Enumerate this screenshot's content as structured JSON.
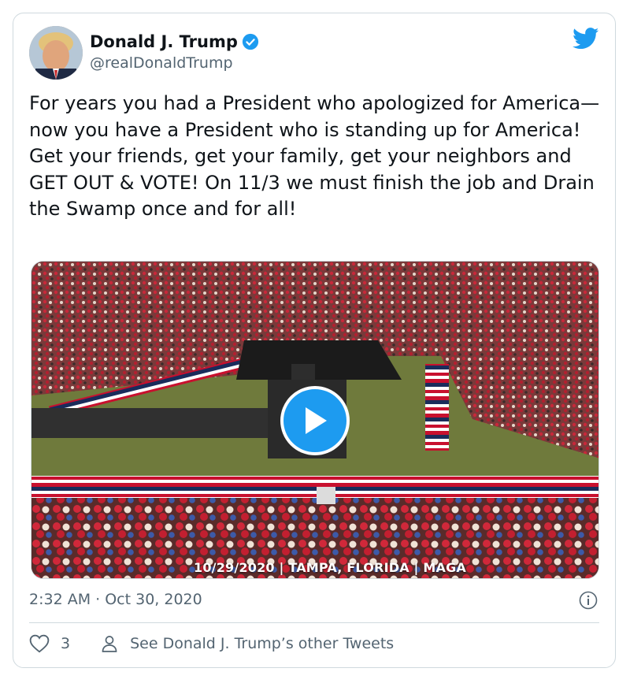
{
  "tweet": {
    "author": {
      "name": "Donald J. Trump",
      "handle": "@realDonaldTrump",
      "verified": true
    },
    "text": "For years you had a President who apologized for America—now you have a President who is standing up for America! Get your friends, get your family, get your neighbors and GET OUT & VOTE! On 11/3 we must finish the job and Drain the Swamp once and for all!",
    "media": {
      "type": "video",
      "caption": "10/29/2020 | TAMPA, FLORIDA | MAGA",
      "icon": "play-icon"
    },
    "timestamp": "2:32 AM · Oct 30, 2020",
    "actions": {
      "like_count": "3",
      "see_more_label": "See Donald J. Trump’s other Tweets"
    }
  },
  "colors": {
    "brand_blue": "#1d9bf0",
    "secondary_text": "#536471",
    "border": "#cfd9de"
  }
}
